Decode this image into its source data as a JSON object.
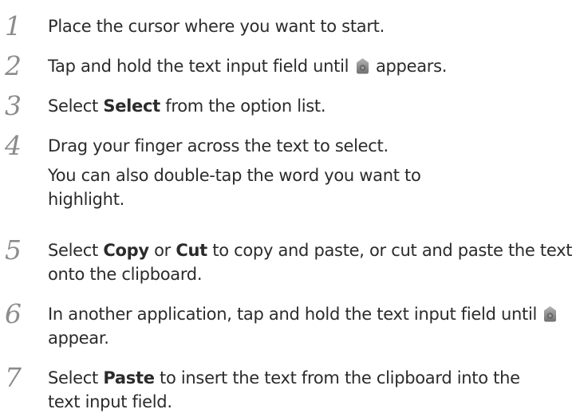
{
  "steps": [
    {
      "number": "1",
      "text": "Place the cursor where you want to start."
    },
    {
      "number": "2",
      "before": "Tap and hold the text input field until",
      "after": "appears.",
      "icon": "cursor-handle-icon"
    },
    {
      "number": "3",
      "before": "Select ",
      "bold": "Select",
      "after": " from the option list."
    },
    {
      "number": "4",
      "text": "Drag your finger across the text to select.",
      "subtext": "You can also double-tap the word you want to highlight."
    },
    {
      "number": "5",
      "before": "Select ",
      "bold1": "Copy",
      "middle": " or ",
      "bold2": "Cut",
      "after": " to copy and paste, or cut and paste the text onto the clipboard."
    },
    {
      "number": "6",
      "before": "In another application, tap and hold the text input field until",
      "after": "appear.",
      "icon": "cursor-handle-icon"
    },
    {
      "number": "7",
      "before": "Select ",
      "bold": "Paste",
      "after": " to insert the text from the clipboard into the text input field."
    }
  ],
  "colors": {
    "text": "#2b2b2b",
    "step_number": "#8c8c8c",
    "icon_body": "#8e8e8e"
  }
}
